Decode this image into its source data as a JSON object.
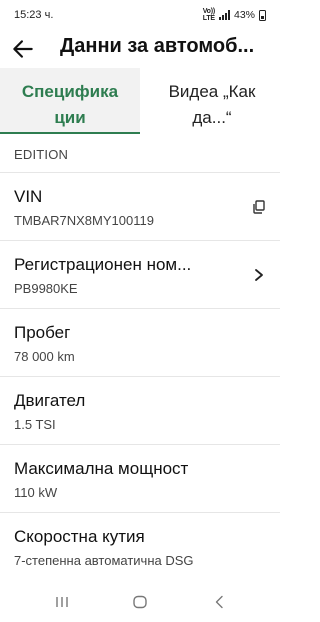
{
  "status_bar": {
    "time": "15:23 ч.",
    "network_line1": "Vo))",
    "network_line2": "LTE",
    "battery": "43%"
  },
  "app_bar": {
    "title": "Данни за автомоб..."
  },
  "tabs": [
    {
      "label": "Специфика ции",
      "active": true
    },
    {
      "label": "Видеа „Как да...“",
      "active": false
    }
  ],
  "content": {
    "partial_top_value": "EDITION",
    "rows": [
      {
        "label": "VIN",
        "value": "TMBAR7NX8MY100119",
        "action_icon": "copy-icon"
      },
      {
        "label": "Регистрационен ном...",
        "value": "PB9980KE",
        "action_icon": "chevron-right-icon"
      },
      {
        "label": "Пробег",
        "value": "78 000 km"
      },
      {
        "label": "Двигател",
        "value": "1.5 TSI"
      },
      {
        "label": "Максимална мощност",
        "value": "110 kW"
      },
      {
        "label": "Скоростна кутия",
        "value": "7-степенна автоматична DSG"
      }
    ]
  },
  "colors": {
    "accent": "#2e7d50",
    "active_tab_bg": "#f2f2f2",
    "divider": "#e6e6e6"
  }
}
